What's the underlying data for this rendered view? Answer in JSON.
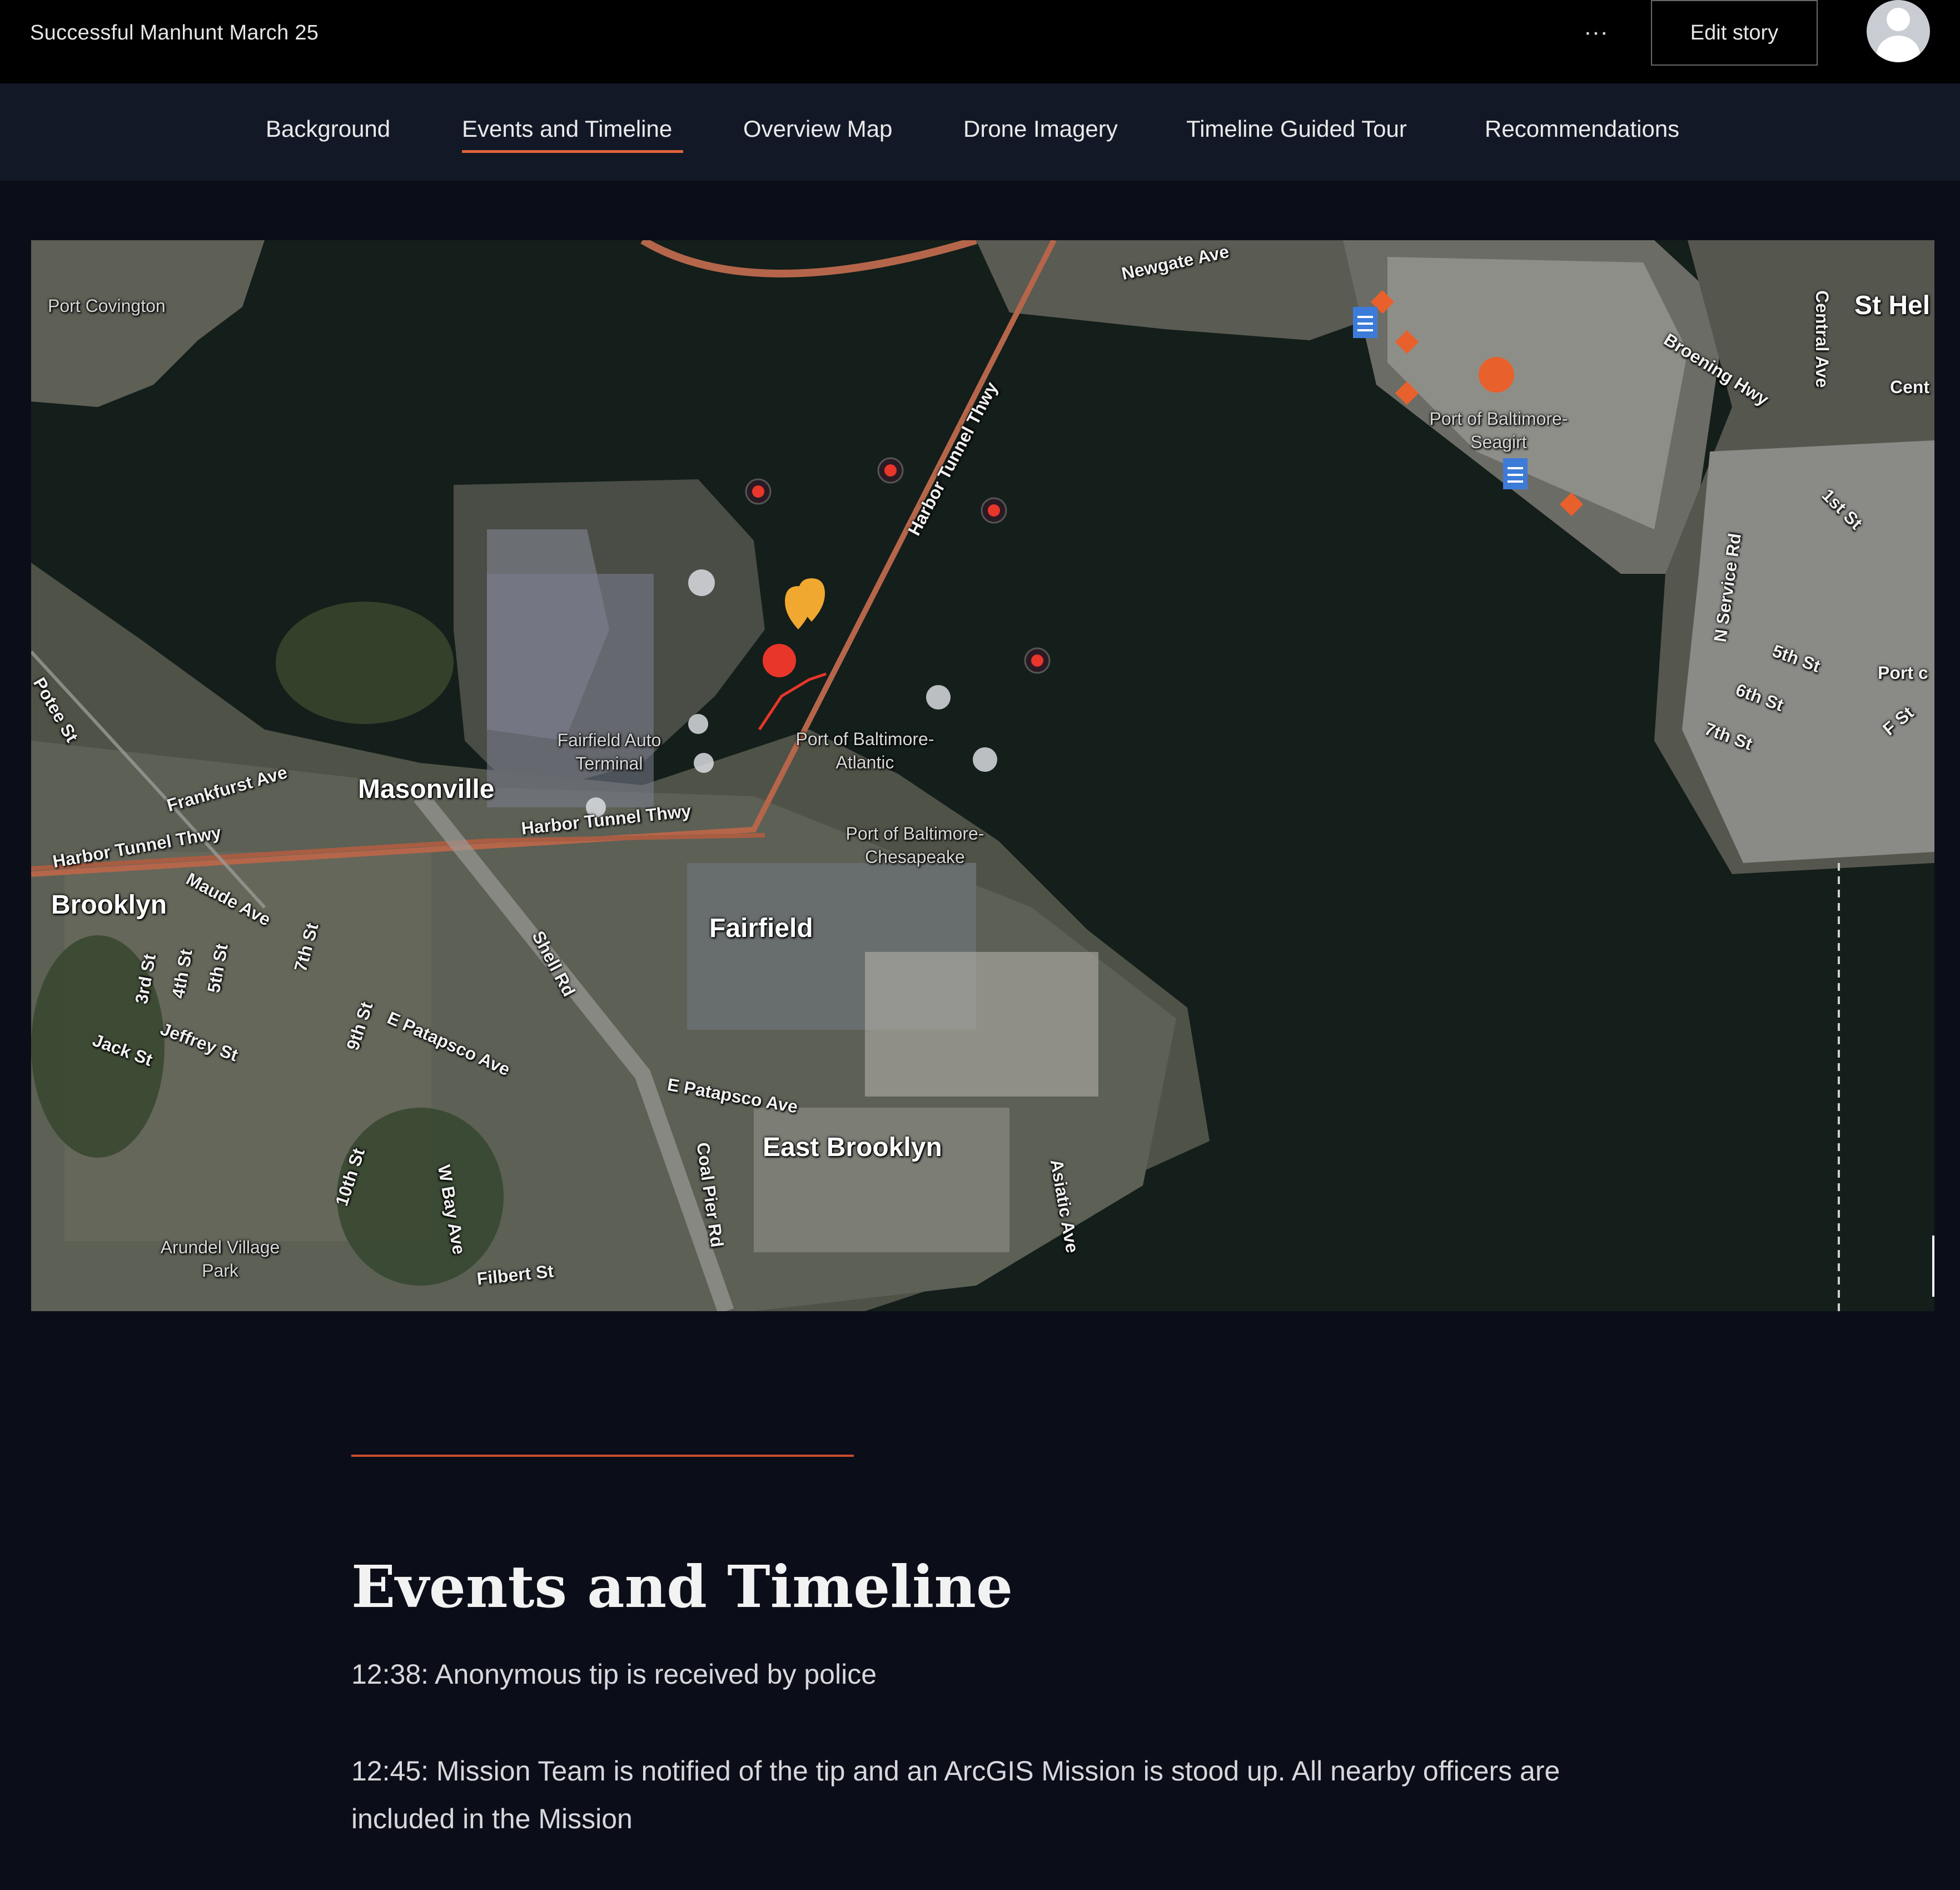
{
  "header": {
    "story_title": "Successful Manhunt March 25",
    "more_label": "···",
    "edit_label": "Edit story",
    "avatar_icon": "user-avatar-icon"
  },
  "nav": {
    "items": [
      {
        "label": "Background"
      },
      {
        "label": "Events and Timeline"
      },
      {
        "label": "Overview Map"
      },
      {
        "label": "Drone Imagery"
      },
      {
        "label": "Timeline Guided Tour"
      },
      {
        "label": "Recommendations"
      }
    ],
    "active_index": 1,
    "accent_color": "#e0643a"
  },
  "map": {
    "labels": {
      "port_covington": "Port Covington",
      "newgate_ave": "Newgate Ave",
      "st_helena": "St Hel",
      "central_ave": "Central Ave",
      "broening_hwy": "Broening Hwy",
      "cent": "Cent",
      "seagirt": "Port of Baltimore-Seagirt",
      "harbor_tunnel_thwy_n": "Harbor Tunnel Thwy",
      "first_st": "1st St",
      "n_service_rd": "N Service Rd",
      "fifth_st": "5th St",
      "sixth_st": "6th St",
      "seventh_st": "7th St",
      "f_st": "F St",
      "port_c": "Port c",
      "potee_st": "Potee St",
      "fairfield_auto": "Fairfield Auto Terminal",
      "atlantic": "Port of Baltimore-Atlantic",
      "masonville": "Masonville",
      "frankfurst_ave": "Frankfurst Ave",
      "harbor_tunnel_thwy_w": "Harbor Tunnel Thwy",
      "harbor_tunnel_thwy_c": "Harbor Tunnel Thwy",
      "chesapeake": "Port of Baltimore-Chesapeake",
      "brooklyn": "Brooklyn",
      "maude_ave": "Maude Ave",
      "seventh_st_w": "7th St",
      "third_st": "3rd St",
      "fourth_st": "4th St",
      "fifth_st_w": "5th St",
      "fairfield": "Fairfield",
      "shell_rd": "Shell Rd",
      "ninth_st": "9th St",
      "e_patapsco_ave": "E Patapsco Ave",
      "jeffrey_st": "Jeffrey St",
      "jack_st": "Jack St",
      "e_patapsco_ave2": "E Patapsco Ave",
      "east_brooklyn": "East Brooklyn",
      "tenth_st": "10th St",
      "w_bay_ave": "W Bay Ave",
      "coal_pier_rd": "Coal Pier Rd",
      "asiatic_ave": "Asiatic Ave",
      "arundel_village_park": "Arundel Village Park",
      "filbert_st": "Filbert St"
    },
    "marker_icons": [
      "police-marker-icon",
      "incident-marker-icon",
      "document-icon",
      "diamond-marker-icon",
      "pin-icon"
    ],
    "colors": {
      "water": "#141e1a",
      "road": "#b5664a",
      "marker_red": "#e8362a",
      "marker_orange": "#e8602c",
      "doc_blue": "#3d7bd9",
      "pin_yellow": "#f0a830"
    }
  },
  "section": {
    "heading": "Events and Timeline",
    "entries": [
      {
        "text": "12:38: Anonymous tip is received by police"
      },
      {
        "text": "12:45: Mission Team is notified of the tip and an ArcGIS Mission is stood up. All nearby officers are included in the Mission"
      }
    ]
  }
}
